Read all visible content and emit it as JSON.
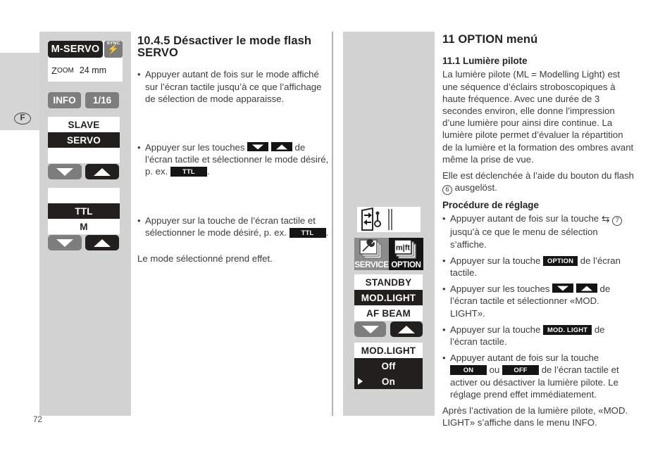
{
  "page": {
    "number": "72",
    "language_badge": "F"
  },
  "left_panel": {
    "lcd_servo": {
      "mode_tag": "M-SERVO",
      "sync_label": "SYNC",
      "sync_icon": "flash-bolt-icon",
      "zoom_label_first": "Z",
      "zoom_label_rest": "OOM",
      "zoom_value": "24 mm"
    },
    "buttons": {
      "info": "INFO",
      "ratio": "1/16"
    },
    "slave_list": {
      "rows": [
        {
          "label": "SLAVE",
          "selected": false
        },
        {
          "label": "SERVO",
          "selected": true
        },
        {
          "label": "",
          "selected": false
        }
      ]
    },
    "arrows_1": {
      "down": "arrow-down-icon",
      "up": "arrow-up-icon"
    },
    "ttl_list": {
      "rows": [
        {
          "label": "",
          "selected": false
        },
        {
          "label": "TTL",
          "selected": true
        },
        {
          "label": "M",
          "selected": false
        }
      ]
    },
    "arrows_2": {
      "down": "arrow-down-icon",
      "up": "arrow-up-icon"
    }
  },
  "mid_panel": {
    "mode_strip_icon": "flash-sync-mode-icon",
    "tiles": [
      {
        "caption": "SERVICE",
        "icon": "wrench-cards-icon"
      },
      {
        "caption": "OPTION",
        "icon": "mft-cards-icon"
      }
    ],
    "standby_list": {
      "rows": [
        {
          "label": "STANDBY",
          "selected": false
        },
        {
          "label": "MOD.LIGHT",
          "selected": true
        },
        {
          "label": "AF BEAM",
          "selected": false
        }
      ]
    },
    "arrows_3": {
      "down": "arrow-down-icon",
      "up": "arrow-up-icon"
    },
    "modlight_list": {
      "title": "MOD.LIGHT",
      "rows": [
        {
          "label": "Off",
          "selected": true,
          "marker": false
        },
        {
          "label": "On",
          "selected": true,
          "marker": true
        }
      ]
    }
  },
  "middle_column": {
    "heading": "10.4.5 Désactiver le mode flash SERVO",
    "bullet_1": "Appuyer autant de fois sur le mode affiché sur l’écran tactile jusqu’à ce que l’affichage de sélection de mode apparaisse.",
    "bullet_2_pre": "Appuyer sur les touches",
    "bullet_2_mid": "de l’écran tactile et sélectionner le mode désiré, p. ex.",
    "bullet_2_chip": "TTL",
    "bullet_2_post": ".",
    "bullet_3_pre": "Appuyer sur la touche de l’écran tactile et sélectionner le mode désiré, p. ex.",
    "bullet_3_chip": "TTL",
    "bullet_3_post": ".",
    "closing": "Le mode sélectionné prend effet."
  },
  "right_column": {
    "heading": "11 OPTION menú",
    "subheading": "11.1 Lumière pilote",
    "para_1": "La lumière pilote (ML = Modelling Light) est une séquence d’éclairs stroboscopiques à haute fréquence. Avec une durée de 3 secondes environ, elle donne l’impression d’une lumière pour ainsi dire continue. La lumière pilote permet d’évaluer la répartition de la lumière et la formation des ombres avant même la prise de vue.",
    "para_2_pre": "Elle est déclenchée à l’aide du bouton du flash",
    "para_2_num": "6",
    "para_2_post": "ausgelöst.",
    "procedure_heading": "Procédure de réglage",
    "step_1_pre": "Appuyer autant de fois sur la touche",
    "step_1_sym": "⇆",
    "step_1_num": "7",
    "step_1_post": "jusqu’à ce que le menu de sélection s’affiche.",
    "step_2_pre": "Appuyer sur la touche",
    "step_2_chip": "OPTION",
    "step_2_post": "de l’écran tactile.",
    "step_3_pre": "Appuyer sur les touches",
    "step_3_post": "de l’écran tactile et sélectionner «MOD. LIGHT».",
    "step_4_pre": "Appuyer sur la touche",
    "step_4_chip": "MOD. LIGHT",
    "step_4_post": "de l’écran tactile.",
    "step_5_pre": "Appuyer autant de fois sur la touche",
    "step_5_chip_on": "ON",
    "step_5_mid": "ou",
    "step_5_chip_off": "OFF",
    "step_5_post": "de l’écran tactile et activer ou désactiver la lumière pilote. Le réglage prend effet immédiatement.",
    "closing": "Après l’activation de la lumière pilote, «MOD. LIGHT» s’affiche dans le menu INFO."
  },
  "colors": {
    "panel_gray": "#d2d2d2",
    "lcd_dark": "#231f1f",
    "button_gray": "#7d7d7d",
    "text": "#3c3c3c"
  }
}
